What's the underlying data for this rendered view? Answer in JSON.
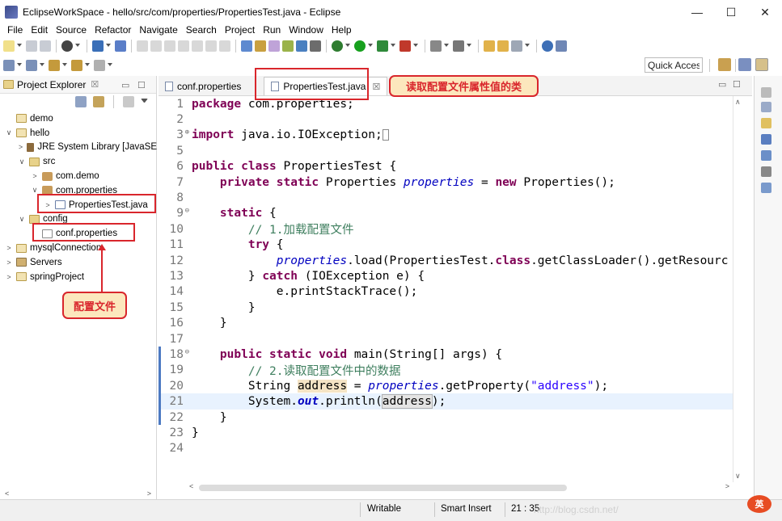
{
  "window": {
    "title": "EclipseWorkSpace - hello/src/com/properties/PropertiesTest.java - Eclipse",
    "controls": {
      "minimize": "—",
      "maximize": "☐",
      "close": "✕"
    }
  },
  "menu": [
    "File",
    "Edit",
    "Source",
    "Refactor",
    "Navigate",
    "Search",
    "Project",
    "Run",
    "Window",
    "Help"
  ],
  "toolbar": {
    "quick_access": "Quick Access"
  },
  "explorer": {
    "title": "Project Explorer",
    "close": "☒",
    "tree": [
      {
        "label": "demo",
        "indent": 0,
        "twisty": "",
        "icon": "project"
      },
      {
        "label": "hello",
        "indent": 0,
        "twisty": "∨",
        "icon": "project"
      },
      {
        "label": "JRE System Library [JavaSE",
        "indent": 1,
        "twisty": ">",
        "icon": "lib"
      },
      {
        "label": "src",
        "indent": 1,
        "twisty": "∨",
        "icon": "folder"
      },
      {
        "label": "com.demo",
        "indent": 2,
        "twisty": ">",
        "icon": "pkg"
      },
      {
        "label": "com.properties",
        "indent": 2,
        "twisty": "∨",
        "icon": "pkg"
      },
      {
        "label": "PropertiesTest.java",
        "indent": 3,
        "twisty": ">",
        "icon": "java"
      },
      {
        "label": "config",
        "indent": 1,
        "twisty": "∨",
        "icon": "folder"
      },
      {
        "label": "conf.properties",
        "indent": 2,
        "twisty": "",
        "icon": "file"
      },
      {
        "label": "mysqlConnection",
        "indent": 0,
        "twisty": ">",
        "icon": "project"
      },
      {
        "label": "Servers",
        "indent": 0,
        "twisty": ">",
        "icon": "server"
      },
      {
        "label": "springProject",
        "indent": 0,
        "twisty": ">",
        "icon": "project"
      }
    ]
  },
  "annotations": {
    "class_callout": "读取配置文件属性值的类",
    "config_callout": "配置文件"
  },
  "editor": {
    "tabs": [
      {
        "label": "conf.properties",
        "active": false
      },
      {
        "label": "PropertiesTest.java",
        "active": true,
        "close": "☒"
      }
    ],
    "lines": [
      {
        "n": "1",
        "html": "<span class='kw'>package</span> com.properties;"
      },
      {
        "n": "2",
        "html": ""
      },
      {
        "n": "3",
        "fold": "⊕",
        "html": "<span class='kw'>import</span> java.io.IOException;<span style='border:1px solid #888;display:inline-block;width:8px;height:14px;vertical-align:middle;'></span>"
      },
      {
        "n": "5",
        "html": ""
      },
      {
        "n": "6",
        "html": "<span class='kw'>public</span> <span class='kw'>class</span> PropertiesTest {"
      },
      {
        "n": "7",
        "html": "    <span class='kw'>private</span> <span class='kw'>static</span> Properties <span class='fld'>properties</span> = <span class='kw'>new</span> Properties();"
      },
      {
        "n": "8",
        "html": ""
      },
      {
        "n": "9",
        "fold": "⊖",
        "html": "    <span class='kw'>static</span> {"
      },
      {
        "n": "10",
        "html": "        <span class='cm'>// 1.加载配置文件</span>"
      },
      {
        "n": "11",
        "html": "        <span class='kw'>try</span> {"
      },
      {
        "n": "12",
        "html": "            <span class='fld'>properties</span>.load(PropertiesTest.<span class='kw'>class</span>.getClassLoader().getResourc"
      },
      {
        "n": "13",
        "html": "        } <span class='kw'>catch</span> (IOException e) {"
      },
      {
        "n": "14",
        "html": "            e.printStackTrace();"
      },
      {
        "n": "15",
        "html": "        }"
      },
      {
        "n": "16",
        "html": "    }"
      },
      {
        "n": "17",
        "html": ""
      },
      {
        "n": "18",
        "fold": "⊖",
        "html": "    <span class='kw'>public</span> <span class='kw'>static</span> <span class='kw'>void</span> main(String[] args) {"
      },
      {
        "n": "19",
        "html": "        <span class='cm'>// 2.读取配置文件中的数据</span>"
      },
      {
        "n": "20",
        "html": "        String <span class='occ'>address</span> = <span class='fld'>properties</span>.getProperty(<span class='str'>\"address\"</span>);"
      },
      {
        "n": "21",
        "current": true,
        "html": "        System.<span class='fld' style='color:#0000c0;font-weight:bold;'>out</span>.println(<span class='occ2'>address</span>);"
      },
      {
        "n": "22",
        "html": "    }"
      },
      {
        "n": "23",
        "html": "}"
      },
      {
        "n": "24",
        "html": ""
      }
    ]
  },
  "status": {
    "writable": "Writable",
    "insert_mode": "Smart Insert",
    "position": "21 : 35",
    "watermark": "http://blog.csdn.net/",
    "brand": "英"
  }
}
